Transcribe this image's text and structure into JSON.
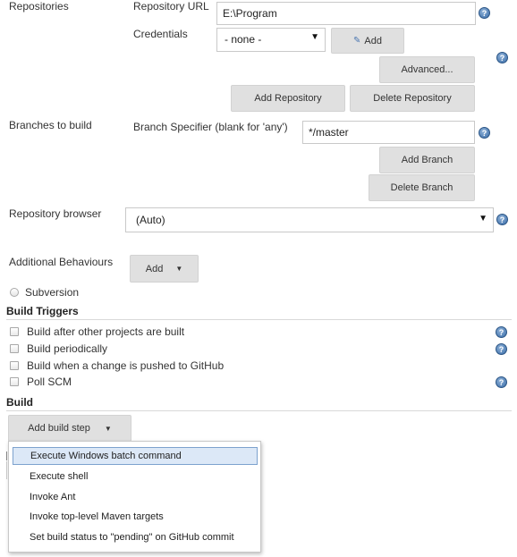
{
  "scm": {
    "repositories_label": "Repositories",
    "repo_url_label": "Repository URL",
    "repo_url_value": "E:\\Program",
    "credentials_label": "Credentials",
    "credentials_value": "- none -",
    "add_label": "Add",
    "advanced_label": "Advanced...",
    "add_repository_label": "Add Repository",
    "delete_repository_label": "Delete Repository",
    "branches_label": "Branches to build",
    "branch_specifier_label": "Branch Specifier (blank for 'any')",
    "branch_specifier_value": "*/master",
    "add_branch_label": "Add Branch",
    "delete_branch_label": "Delete Branch",
    "repo_browser_label": "Repository browser",
    "repo_browser_value": "(Auto)",
    "additional_behaviours_label": "Additional Behaviours",
    "additional_add_label": "Add",
    "subversion_label": "Subversion"
  },
  "build_triggers": {
    "title": "Build Triggers",
    "items": [
      {
        "label": "Build after other projects are built"
      },
      {
        "label": "Build periodically"
      },
      {
        "label": "Build when a change is pushed to GitHub"
      },
      {
        "label": "Poll SCM"
      }
    ]
  },
  "build": {
    "title": "Build",
    "add_build_step_label": "Add build step",
    "menu_items": [
      {
        "label": "Execute Windows batch command"
      },
      {
        "label": "Execute shell"
      },
      {
        "label": "Invoke Ant"
      },
      {
        "label": "Invoke top-level Maven targets"
      },
      {
        "label": "Set build status to \"pending\" on GitHub commit"
      }
    ]
  },
  "icons": {
    "help": "help-icon",
    "dropdown": "chevron-down-icon",
    "add": "key-add-icon"
  },
  "colors": {
    "button_bg": "#e0e0e0",
    "help_blue": "#3a6ca8",
    "menu_highlight": "#dce8f7"
  }
}
